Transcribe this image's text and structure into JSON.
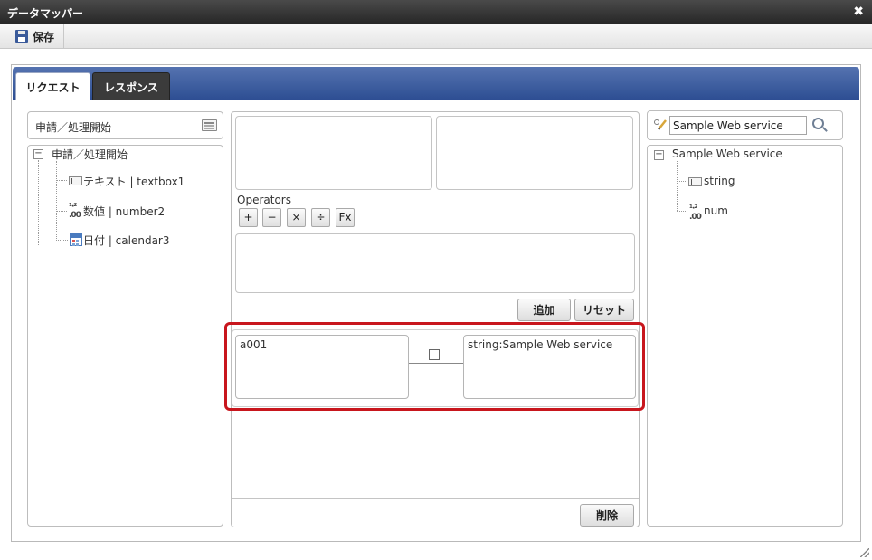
{
  "window": {
    "title": "データマッパー",
    "close_label": "✖"
  },
  "toolbar": {
    "save_label": "保存"
  },
  "tabs": [
    {
      "label": "リクエスト",
      "active": true
    },
    {
      "label": "レスポンス",
      "active": false
    }
  ],
  "left_panel": {
    "header": "申請／処理開始",
    "tree": {
      "root": {
        "label": "申請／処理開始",
        "toggle": "−"
      },
      "items": [
        {
          "label": "テキスト | textbox1",
          "icon": "textbox-icon"
        },
        {
          "label": "数値 | number2",
          "icon": "number-icon"
        },
        {
          "label": "日付 | calendar3",
          "icon": "calendar-icon"
        }
      ]
    }
  },
  "center": {
    "operators_label": "Operators",
    "operators": [
      "+",
      "−",
      "×",
      "÷",
      "Fx"
    ],
    "add_label": "追加",
    "reset_label": "リセット",
    "mapping": {
      "source": "a001",
      "target": "string:Sample Web service"
    },
    "delete_label": "削除"
  },
  "right_panel": {
    "search_value": "Sample Web service",
    "tree": {
      "root": {
        "label": "Sample Web service",
        "toggle": "−"
      },
      "items": [
        {
          "label": "string",
          "icon": "textbox-icon"
        },
        {
          "label": "num",
          "icon": "number-icon"
        }
      ]
    }
  },
  "icons": {
    "num_glyph_top": "¹·²",
    "num_glyph_bottom": ".00"
  },
  "colors": {
    "tabbar": "#2c4d92",
    "highlight": "#c8161d",
    "titlebar": "#262626"
  }
}
